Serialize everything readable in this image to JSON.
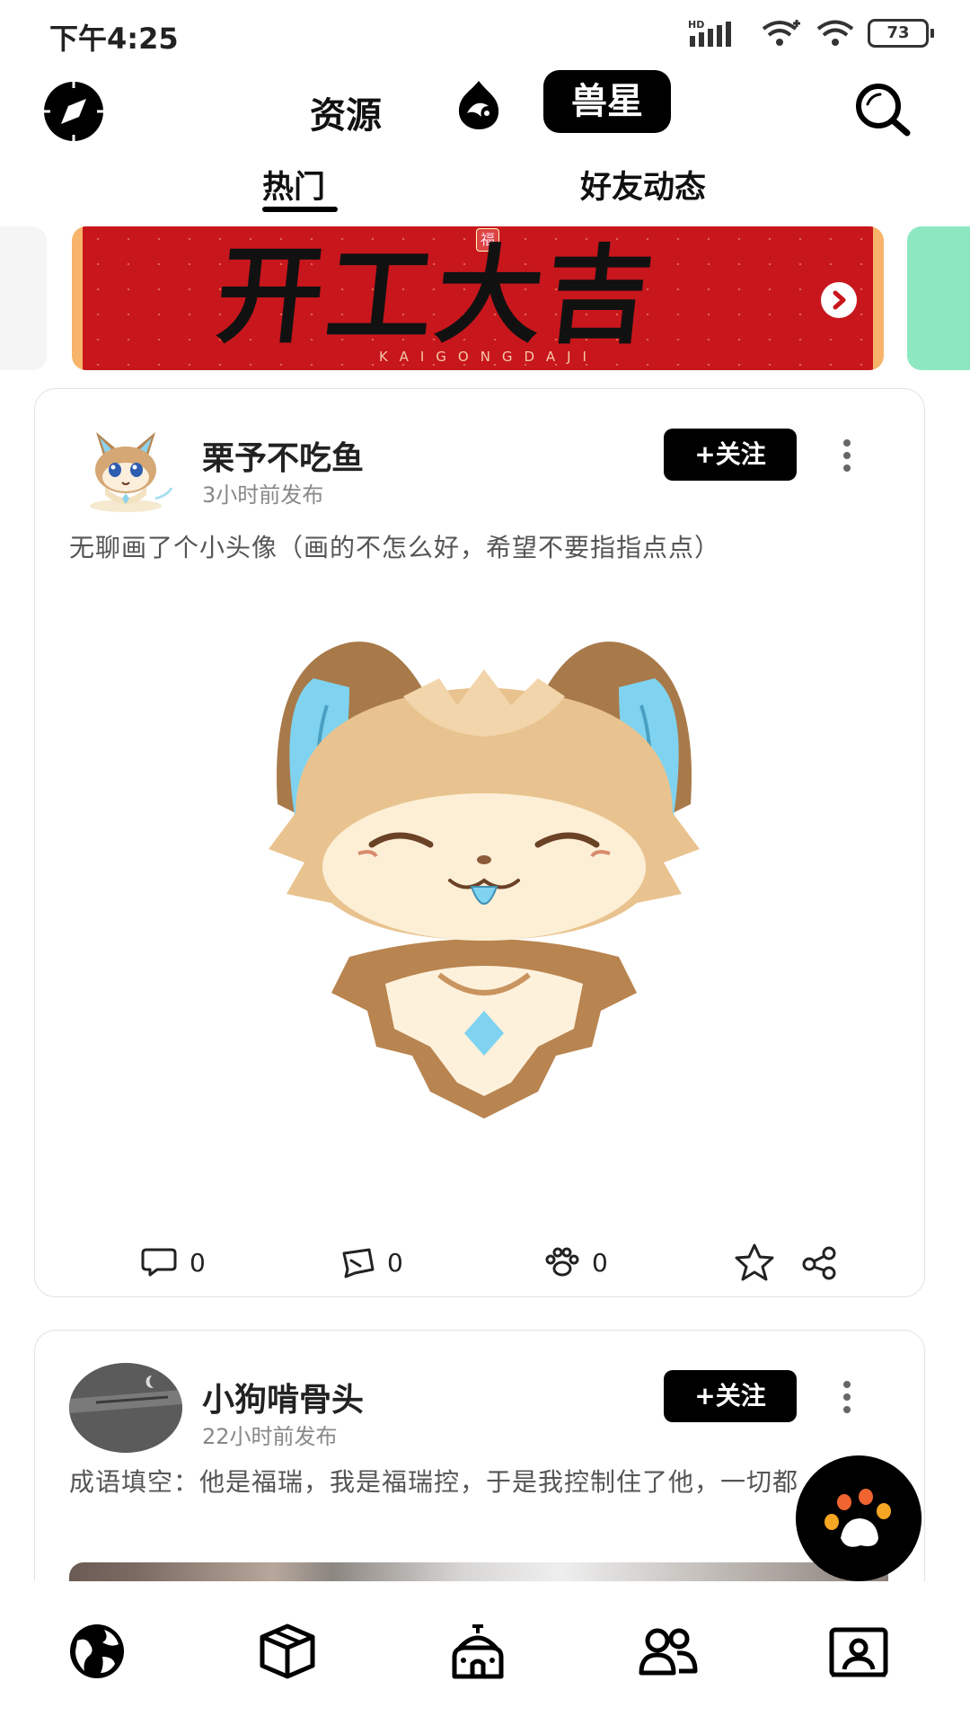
{
  "status_bar": {
    "time": "下午4:25",
    "battery": "73",
    "hd_label": "HD"
  },
  "header": {
    "tab_resources": "资源",
    "tab_stars": "兽星"
  },
  "subtabs": {
    "hot": "热门",
    "friends": "好友动态"
  },
  "banner": {
    "title": "开工大吉",
    "pinyin": "KAIGONGDAJI",
    "fu_char": "福"
  },
  "posts": [
    {
      "username": "栗予不吃鱼",
      "time": "3小时前发布",
      "follow_label": "+关注",
      "text": "无聊画了个小头像（画的不怎么好，希望不要指指点点）",
      "comments": "0",
      "reposts": "0",
      "likes": "0"
    },
    {
      "username": "小狗啃骨头",
      "time": "22小时前发布",
      "follow_label": "+关注",
      "text": "成语填空：他是福瑞，我是福瑞控，于是我控制住了他，一切都（  ）"
    }
  ],
  "colors": {
    "accent": "#000000",
    "banner_red": "#c8161d",
    "banner_side": "#f7b46a",
    "next_banner": "#8de8c2",
    "ear_blue": "#7fd3f0"
  },
  "icons": {
    "header_left": "compass-icon",
    "header_logo": "fox-logo-icon",
    "header_right": "search-icon",
    "nav": [
      "world-icon",
      "box-icon",
      "temple-icon",
      "friends-icon",
      "profile-card-icon"
    ],
    "fab": "paw-icon"
  }
}
